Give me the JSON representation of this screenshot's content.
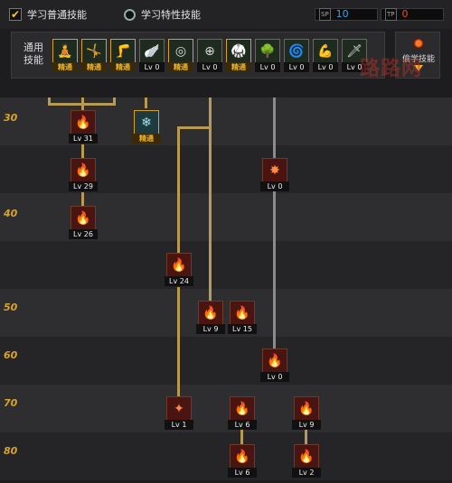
{
  "modes": {
    "normal_label": "学习普通技能",
    "special_label": "学习特性技能"
  },
  "counters": {
    "sp_tag": "SP",
    "sp_value": "10",
    "tp_tag": "TP",
    "tp_value": "0"
  },
  "general": {
    "label": "通用技能",
    "skills": [
      {
        "label": "精通",
        "icon": "meditate-icon"
      },
      {
        "label": "精通",
        "icon": "leap-icon"
      },
      {
        "label": "精通",
        "icon": "kick-icon"
      },
      {
        "label": "Lv 0",
        "icon": "wing-icon"
      },
      {
        "label": "精通",
        "icon": "target-icon"
      },
      {
        "label": "Lv 0",
        "icon": "crosshair-icon"
      },
      {
        "label": "精通",
        "icon": "stance-icon"
      },
      {
        "label": "Lv 0",
        "icon": "tree-icon"
      },
      {
        "label": "Lv 0",
        "icon": "swirl-icon"
      },
      {
        "label": "Lv 0",
        "icon": "strength-icon"
      },
      {
        "label": "Lv 0",
        "icon": "sword-icon"
      }
    ]
  },
  "steal": {
    "label": "偷学技能"
  },
  "watermark": "路路网",
  "tree": {
    "levels": [
      "30",
      "40",
      "50",
      "60",
      "70",
      "80"
    ],
    "skills": [
      {
        "label": "Lv 31",
        "icon": "flame-hook-icon"
      },
      {
        "label": "精通",
        "icon": "ice-slash-icon"
      },
      {
        "label": "Lv 29",
        "icon": "fire-claw-icon"
      },
      {
        "label": "Lv 0",
        "icon": "dark-burst-icon"
      },
      {
        "label": "Lv 26",
        "icon": "fire-strike-icon"
      },
      {
        "label": "Lv 24",
        "icon": "fire-dash-icon"
      },
      {
        "label": "Lv 9",
        "icon": "fire-blast-icon"
      },
      {
        "label": "Lv 15",
        "icon": "green-flame-icon"
      },
      {
        "label": "Lv 0",
        "icon": "fire-orb-icon"
      },
      {
        "label": "Lv 1",
        "icon": "light-pillar-icon"
      },
      {
        "label": "Lv 6",
        "icon": "poison-fire-icon"
      },
      {
        "label": "Lv 9",
        "icon": "fire-sword-icon"
      },
      {
        "label": "Lv 6",
        "icon": "fire-burst-icon"
      },
      {
        "label": "Lv 2",
        "icon": "fire-wave-icon"
      }
    ]
  }
}
